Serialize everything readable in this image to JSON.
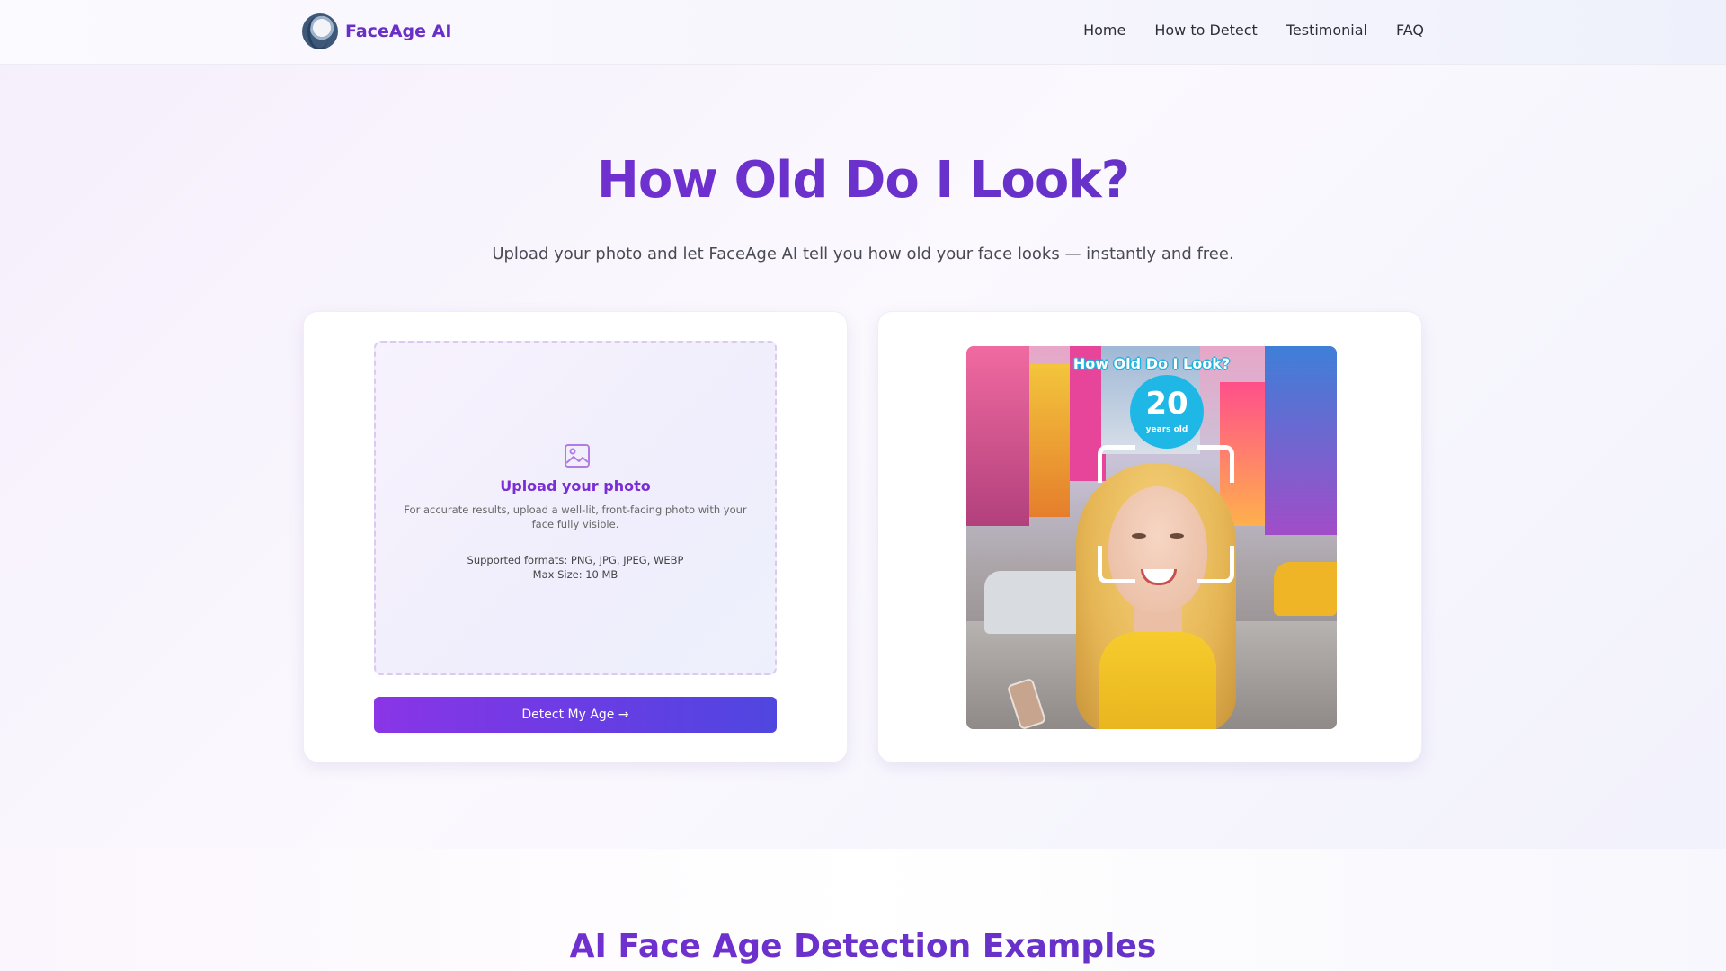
{
  "nav": {
    "brand": "FaceAge AI",
    "links": [
      "Home",
      "How to Detect",
      "Testimonial",
      "FAQ"
    ]
  },
  "hero": {
    "title": "How Old Do I Look?",
    "subtitle": "Upload your photo and let FaceAge AI tell you how old your face looks — instantly and free."
  },
  "upload": {
    "title": "Upload your photo",
    "hint": "For accurate results, upload a well-lit, front-facing photo with your face fully visible.",
    "formats": "Supported formats: PNG, JPG, JPEG, WEBP",
    "max_size": "Max Size: 10 MB",
    "button": "Detect My Age →"
  },
  "example": {
    "overlay_title": "How Old Do I Look?",
    "age": "20",
    "age_unit": "years old"
  },
  "section2": {
    "title": "AI Face Age Detection Examples"
  },
  "colors": {
    "accent": "#7a2ed6",
    "button_start": "#8a35e6",
    "button_end": "#4f46e0",
    "age_badge": "#1fb8e6"
  },
  "icons": [
    "logo-icon",
    "image-upload-icon"
  ]
}
